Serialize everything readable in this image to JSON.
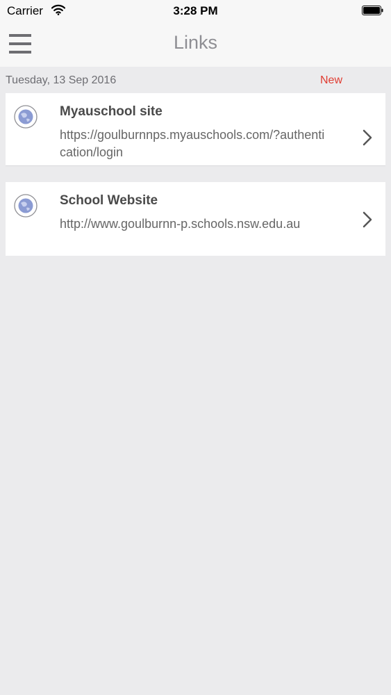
{
  "status_bar": {
    "carrier": "Carrier",
    "time": "3:28 PM"
  },
  "nav": {
    "title": "Links"
  },
  "section": {
    "date": "Tuesday, 13 Sep 2016",
    "badge": "New"
  },
  "links": [
    {
      "title": "Myauschool site",
      "url": "https://goulburnnps.myauschools.com/?authentication/login",
      "icon": "globe-icon"
    },
    {
      "title": "School Website",
      "url": "http://www.goulburnn-p.schools.nsw.edu.au",
      "icon": "globe-icon"
    }
  ],
  "colors": {
    "background": "#ebebed",
    "badge": "#e03c31",
    "globe": "#7b8cc9"
  }
}
